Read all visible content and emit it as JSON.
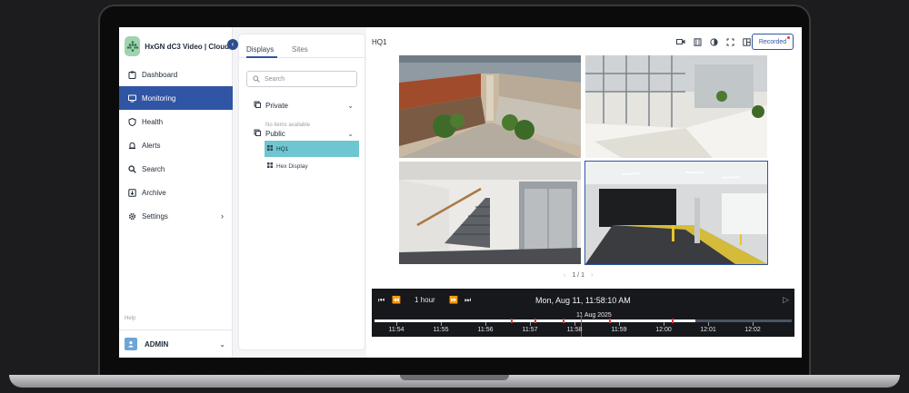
{
  "app": {
    "title": "HxGN dC3 Video | Cloud"
  },
  "sidebar": {
    "items": [
      {
        "label": "Dashboard",
        "icon": "clipboard-icon"
      },
      {
        "label": "Monitoring",
        "icon": "monitor-icon",
        "active": true
      },
      {
        "label": "Health",
        "icon": "shield-icon"
      },
      {
        "label": "Alerts",
        "icon": "alarm-icon"
      },
      {
        "label": "Search",
        "icon": "search-icon"
      },
      {
        "label": "Archive",
        "icon": "archive-icon"
      },
      {
        "label": "Settings",
        "icon": "gear-icon"
      }
    ],
    "help_label": "Help",
    "user_name": "ADMIN"
  },
  "panel": {
    "tabs": [
      "Displays",
      "Sites"
    ],
    "search_placeholder": "Search",
    "groups": {
      "private": {
        "label": "Private",
        "empty_text": "No items available"
      },
      "public": {
        "label": "Public",
        "items": [
          "HQ1",
          "Hex Display"
        ]
      }
    }
  },
  "main": {
    "view_title": "HQ1",
    "recorded_label": "Recorded",
    "pager": "1 / 1"
  },
  "timeline": {
    "duration_label": "1 hour",
    "datetime": "Mon, Aug 11, 11:58:10 AM",
    "day_label": "11 Aug 2025",
    "ticks": [
      "11:54",
      "11:55",
      "11:56",
      "11:57",
      "11:58",
      "11:59",
      "12:00",
      "12:01",
      "12:02"
    ]
  },
  "colors": {
    "accent": "#2f55a4",
    "selected_item": "#6ec6d0",
    "event_marker": "#e03a3a",
    "logo_bg": "#9fd4ae"
  }
}
